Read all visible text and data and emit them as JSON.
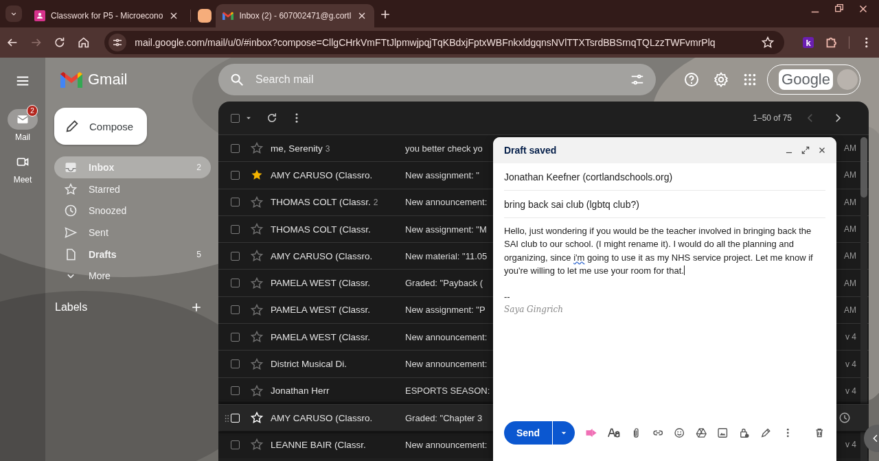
{
  "browser": {
    "tabs": [
      {
        "kind": "page",
        "title": "Classwork for P5 - Microecono",
        "selected": false
      },
      {
        "kind": "group",
        "color": "#f6ad7b"
      },
      {
        "kind": "page",
        "title": "Inbox (2) - 607002471@g.cortl",
        "selected": true
      }
    ],
    "forward_disabled": true,
    "url": "mail.google.com/mail/u/0/#inbox?compose=CllgCHrkVmFTtJlpmwjpqjTqKBdxjFptxWBFnkxldgqnsNVlTTXTsrdBBSrnqTQLzzTWFvmrPlq",
    "extension_label": "k"
  },
  "rail": [
    {
      "label": "Mail",
      "badge": "2",
      "selected": true
    },
    {
      "label": "Meet",
      "selected": false
    }
  ],
  "app": {
    "name": "Gmail"
  },
  "search": {
    "placeholder": "Search mail"
  },
  "account": {
    "label": "Google"
  },
  "compose_button": "Compose",
  "folders": [
    {
      "label": "Inbox",
      "count": "2",
      "bold": true,
      "selected": true
    },
    {
      "label": "Starred",
      "bold": false,
      "selected": false
    },
    {
      "label": "Snoozed",
      "bold": false,
      "selected": false
    },
    {
      "label": "Sent",
      "bold": false,
      "selected": false
    },
    {
      "label": "Drafts",
      "count": "5",
      "bold": true,
      "selected": false
    },
    {
      "label": "More",
      "bold": false,
      "selected": false
    }
  ],
  "labels": {
    "title": "Labels"
  },
  "list": {
    "select_all_checked": false,
    "range": "1–50 of 75",
    "prev_disabled": true,
    "rows": [
      {
        "sender": "me, Serenity",
        "count": "3",
        "subject": "you better check yo",
        "date": "AM",
        "starred": false,
        "hovered": false
      },
      {
        "sender": "AMY CARUSO (Classro.",
        "subject": "New assignment: \"",
        "date": "AM",
        "starred": true,
        "hovered": false
      },
      {
        "sender": "THOMAS COLT (Classr.",
        "count": "2",
        "subject": "New announcement:",
        "date": "AM",
        "starred": false,
        "hovered": false
      },
      {
        "sender": "THOMAS COLT (Classr.",
        "subject": "New assignment: \"M",
        "date": "AM",
        "starred": false,
        "hovered": false
      },
      {
        "sender": "AMY CARUSO (Classro.",
        "subject": "New material: \"11.05",
        "date": "AM",
        "starred": false,
        "hovered": false
      },
      {
        "sender": "PAMELA WEST (Classr.",
        "subject": "Graded: \"Payback (",
        "date": "AM",
        "starred": false,
        "hovered": false
      },
      {
        "sender": "PAMELA WEST (Classr.",
        "subject": "New assignment: \"P",
        "date": "AM",
        "starred": false,
        "hovered": false
      },
      {
        "sender": "PAMELA WEST (Classr.",
        "subject": "New announcement:",
        "date": "v 4",
        "starred": false,
        "hovered": false
      },
      {
        "sender": "District Musical Di.",
        "subject": "New announcement:",
        "date": "v 4",
        "starred": false,
        "hovered": false
      },
      {
        "sender": "Jonathan Herr",
        "subject": "ESPORTS SEASON:",
        "date": "v 4",
        "starred": false,
        "hovered": false
      },
      {
        "sender": "AMY CARUSO (Classro.",
        "subject": "Graded: \"Chapter 3",
        "starred": false,
        "hovered": true
      },
      {
        "sender": "LEANNE BAIR (Classr.",
        "subject": "New announcement:",
        "date": "v 4",
        "starred": false,
        "hovered": false
      }
    ]
  },
  "compose": {
    "title": "Draft saved",
    "to": "Jonathan Keefner (cortlandschools.org)",
    "subject": "bring back sai club (lgbtq club?)",
    "body": [
      {
        "text": "Hello, just wondering if you would be the teacher involved in bringing back the SAI club to our school. (I might rename it). I would do all the planning and organizing, since ",
        "misspelled": false
      },
      {
        "text": "i'm",
        "misspelled": true
      },
      {
        "text": " going to use it as my NHS service project. Let me know if you're willing to let me use your room for that.",
        "misspelled": false
      }
    ],
    "signature_separator": "--",
    "signature": "Saya Gingrich",
    "send": "Send"
  }
}
